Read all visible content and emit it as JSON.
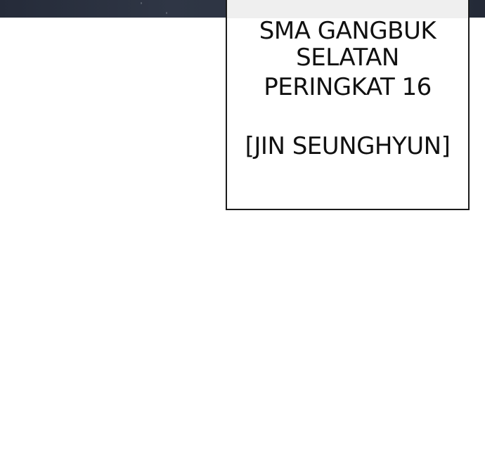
{
  "caption": {
    "lines": [
      "SMA GANGBUK",
      "SELATAN",
      "PERINGKAT 16",
      "[JIN SEUNGHYUN]"
    ]
  },
  "colors": {
    "top_band": "#2b3241",
    "background": "#ffffff",
    "border": "#1a1a1a",
    "text": "#111111"
  }
}
